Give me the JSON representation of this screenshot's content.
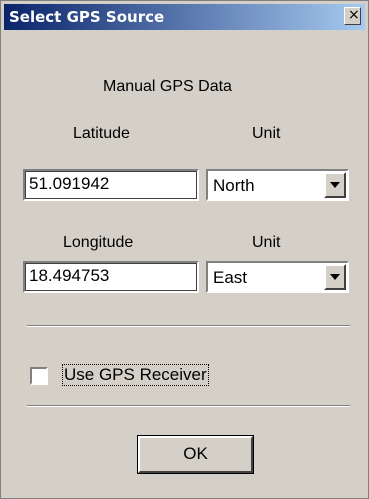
{
  "window": {
    "title": "Select GPS Source",
    "close_glyph": "×",
    "close_icon": "close-icon"
  },
  "section": {
    "heading": "Manual GPS Data"
  },
  "latitude": {
    "label": "Latitude",
    "unit_label": "Unit",
    "value": "51.091942",
    "unit_value": "North"
  },
  "longitude": {
    "label": "Longitude",
    "unit_label": "Unit",
    "value": "18.494753",
    "unit_value": "East"
  },
  "receiver": {
    "checkbox_label": "Use GPS Receiver",
    "checked": false
  },
  "buttons": {
    "ok_label": "OK"
  },
  "colors": {
    "dialog_bg": "#d4d0c8",
    "title_start": "#0a246a",
    "title_end": "#a6caf0"
  }
}
